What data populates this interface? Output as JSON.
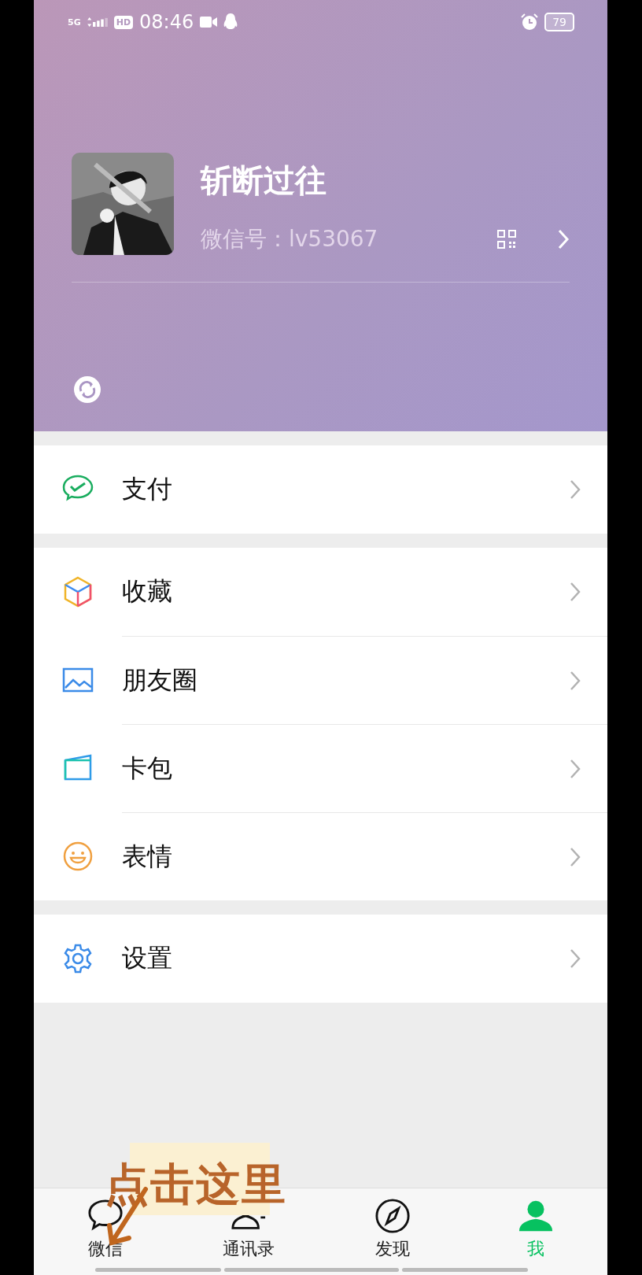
{
  "status_bar": {
    "network": "5G",
    "hd": "HD",
    "time": "08:46",
    "battery": "79"
  },
  "profile": {
    "name": "斩断过往",
    "wechat_id": "微信号：lv53067"
  },
  "menu_groups": [
    [
      {
        "kind": "pay",
        "label": "支付"
      }
    ],
    [
      {
        "kind": "favorites",
        "label": "收藏"
      },
      {
        "kind": "moments",
        "label": "朋友圈"
      },
      {
        "kind": "cards",
        "label": "卡包"
      },
      {
        "kind": "stickers",
        "label": "表情"
      }
    ],
    [
      {
        "kind": "settings",
        "label": "设置"
      }
    ]
  ],
  "tab_bar": [
    {
      "kind": "chats",
      "label": "微信",
      "selected": false
    },
    {
      "kind": "contacts",
      "label": "通讯录",
      "selected": false
    },
    {
      "kind": "discover",
      "label": "发现",
      "selected": false
    },
    {
      "kind": "me",
      "label": "我",
      "selected": true
    }
  ],
  "annotation": {
    "text": "点击这里"
  }
}
